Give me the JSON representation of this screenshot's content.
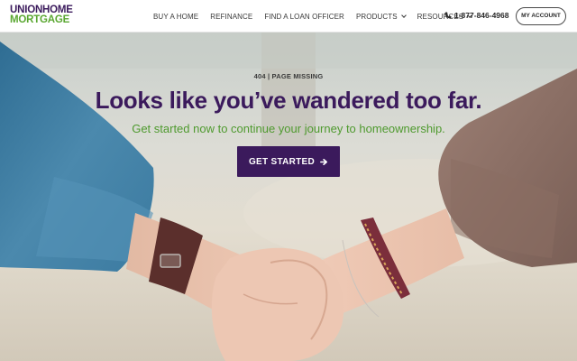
{
  "header": {
    "logo": {
      "line1": "UNIONHOME",
      "line2": "MORTGAGE"
    },
    "nav": [
      {
        "label": "BUY A HOME",
        "dropdown": false
      },
      {
        "label": "REFINANCE",
        "dropdown": false
      },
      {
        "label": "FIND A LOAN OFFICER",
        "dropdown": false
      },
      {
        "label": "PRODUCTS",
        "dropdown": true
      },
      {
        "label": "RESOURCES",
        "dropdown": true
      }
    ],
    "phone": "1-877-846-4968",
    "account_label": "MY ACCOUNT"
  },
  "hero": {
    "eyebrow": "404 | PAGE MISSING",
    "headline": "Looks like you’ve wandered too far.",
    "subline": "Get started now to continue your journey to homeownership.",
    "cta_label": "GET STARTED"
  },
  "colors": {
    "brand_purple": "#3b1a5c",
    "brand_green": "#5aa731"
  },
  "icons": {
    "phone": "phone-icon",
    "cta": "arrow-right-icon",
    "dropdown": "chevron-down-icon"
  }
}
